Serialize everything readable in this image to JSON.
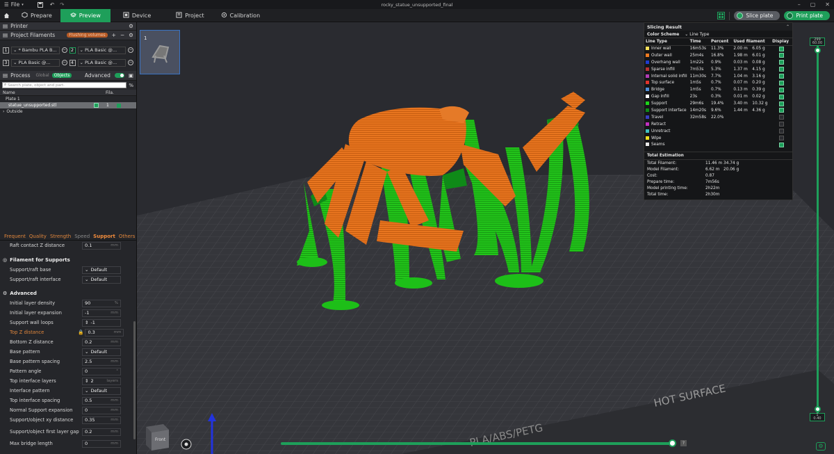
{
  "titlebar": {
    "file_menu": "File",
    "filename": "rocky_statue_unsupported_final"
  },
  "toolbar": {
    "tabs": [
      {
        "label": "Prepare",
        "icon": "prepare-icon"
      },
      {
        "label": "Preview",
        "icon": "preview-icon",
        "active": true
      },
      {
        "label": "Device",
        "icon": "device-icon"
      },
      {
        "label": "Project",
        "icon": "project-icon"
      },
      {
        "label": "Calibration",
        "icon": "calibration-icon"
      }
    ],
    "slice_label": "Slice plate",
    "print_label": "Print plate",
    "accent": "#1e9f5a"
  },
  "left": {
    "printer_title": "Printer",
    "filaments_title": "Project Filaments",
    "flushing_badge": "Flushing volumes",
    "filaments": [
      {
        "num": "1",
        "name": "* Bambu PLA B...",
        "color": "#2a2b30"
      },
      {
        "num": "2",
        "name": "PLA Basic @...",
        "color": "#1e9f5a"
      },
      {
        "num": "3",
        "name": "PLA Basic @...",
        "color": "#2a2b30"
      },
      {
        "num": "4",
        "name": "PLA Basic @...",
        "color": "#2a2b30"
      }
    ],
    "process_title": "Process",
    "global_label": "Global",
    "objects_label": "Objects",
    "advanced_label": "Advanced",
    "search_placeholder": "Search plate, object and part.",
    "col_name": "Name",
    "col_fila": "Fila.",
    "plate_label": "Plate 1",
    "object_name": "statue_unsupported.stl",
    "object_fila": "1",
    "outside_label": "Outside",
    "ptabs": [
      "Frequent",
      "Quality",
      "Strength",
      "Speed",
      "Support",
      "Others"
    ],
    "params_top": [
      {
        "label": "Raft contact Z distance",
        "value": "0.1",
        "unit": "mm"
      }
    ],
    "filament_supports_title": "Filament for Supports",
    "params_fil": [
      {
        "label": "Support/raft base",
        "value": "Default"
      },
      {
        "label": "Support/raft interface",
        "value": "Default"
      }
    ],
    "advanced_group": "Advanced",
    "params_adv": [
      {
        "label": "Initial layer density",
        "value": "90",
        "unit": "%"
      },
      {
        "label": "Initial layer expansion",
        "value": "-1",
        "unit": "mm"
      },
      {
        "label": "Support wall loops",
        "value": "-1",
        "unit": ""
      },
      {
        "label": "Top Z distance",
        "value": "0.3",
        "unit": "mm"
      },
      {
        "label": "Bottom Z distance",
        "value": "0.2",
        "unit": "mm"
      },
      {
        "label": "Base pattern",
        "value": "Default",
        "unit": ""
      },
      {
        "label": "Base pattern spacing",
        "value": "2.5",
        "unit": "mm"
      },
      {
        "label": "Pattern angle",
        "value": "0",
        "unit": "°"
      },
      {
        "label": "Top interface layers",
        "value": "2",
        "unit": "layers"
      },
      {
        "label": "Interface pattern",
        "value": "Default",
        "unit": ""
      },
      {
        "label": "Top interface spacing",
        "value": "0.5",
        "unit": "mm"
      },
      {
        "label": "Normal Support expansion",
        "value": "0",
        "unit": "mm"
      },
      {
        "label": "Support/object xy distance",
        "value": "0.35",
        "unit": "mm"
      },
      {
        "label": "Support/object first layer gap",
        "value": "0.2",
        "unit": "mm"
      },
      {
        "label": "Max bridge length",
        "value": "0",
        "unit": "mm"
      }
    ]
  },
  "plate": {
    "number": "1",
    "bed_text": "HOT SURFACE",
    "bed_text2": "PLA/ABS/PETG",
    "cube_label": "Front"
  },
  "result": {
    "title": "Slicing Result",
    "color_scheme_label": "Color Scheme",
    "color_scheme_value": "Line Type",
    "headers": [
      "Line Type",
      "Time",
      "Percent",
      "Used filament",
      "Display"
    ],
    "rows": [
      {
        "type": "Inner wall",
        "time": "16m53s",
        "percent": "11.3%",
        "length": "2.00 m",
        "weight": "6.05 g",
        "color": "#f7e15b",
        "on": true
      },
      {
        "type": "Outer wall",
        "time": "25m4s",
        "percent": "16.8%",
        "length": "1.98 m",
        "weight": "6.01 g",
        "color": "#ef7b21",
        "on": true
      },
      {
        "type": "Overhang wall",
        "time": "1m22s",
        "percent": "0.9%",
        "length": "0.03 m",
        "weight": "0.08 g",
        "color": "#1f3cd0",
        "on": true
      },
      {
        "type": "Sparse infill",
        "time": "7m53s",
        "percent": "5.3%",
        "length": "1.37 m",
        "weight": "4.15 g",
        "color": "#b83232",
        "on": true
      },
      {
        "type": "Internal solid infill",
        "time": "11m30s",
        "percent": "7.7%",
        "length": "1.04 m",
        "weight": "3.16 g",
        "color": "#b23cb6",
        "on": true
      },
      {
        "type": "Top surface",
        "time": "1m5s",
        "percent": "0.7%",
        "length": "0.07 m",
        "weight": "0.20 g",
        "color": "#e0342c",
        "on": true
      },
      {
        "type": "Bridge",
        "time": "1m5s",
        "percent": "0.7%",
        "length": "0.13 m",
        "weight": "0.39 g",
        "color": "#4f8fd8",
        "on": true
      },
      {
        "type": "Gap infill",
        "time": "23s",
        "percent": "0.3%",
        "length": "0.01 m",
        "weight": "0.02 g",
        "color": "#ffffff",
        "on": true
      },
      {
        "type": "Support",
        "time": "29m6s",
        "percent": "19.4%",
        "length": "3.40 m",
        "weight": "10.32 g",
        "color": "#1dd41a",
        "on": true
      },
      {
        "type": "Support interface",
        "time": "14m20s",
        "percent": "9.6%",
        "length": "1.44 m",
        "weight": "4.36 g",
        "color": "#0f8a18",
        "on": true
      },
      {
        "type": "Travel",
        "time": "32m58s",
        "percent": "22.0%",
        "length": "",
        "weight": "",
        "color": "#383ec0",
        "on": false
      },
      {
        "type": "Retract",
        "time": "",
        "percent": "",
        "length": "",
        "weight": "",
        "color": "#c030c0",
        "on": false
      },
      {
        "type": "Unretract",
        "time": "",
        "percent": "",
        "length": "",
        "weight": "",
        "color": "#40c0c0",
        "on": false
      },
      {
        "type": "Wipe",
        "time": "",
        "percent": "",
        "length": "",
        "weight": "",
        "color": "#f0e020",
        "on": false
      },
      {
        "type": "Seams",
        "time": "",
        "percent": "",
        "length": "",
        "weight": "",
        "color": "#e8e8e8",
        "on": true
      }
    ],
    "estimation_title": "Total Estimation",
    "estimation": [
      {
        "label": "Total Filament:",
        "a": "11.46 m",
        "b": "34.74 g"
      },
      {
        "label": "Model Filament:",
        "a": "6.62 m",
        "b": "20.06 g"
      },
      {
        "label": "Cost:",
        "a": "0.87",
        "b": ""
      },
      {
        "label": "Prepare time:",
        "a": "7m56s",
        "b": ""
      },
      {
        "label": "Model printing time:",
        "a": "2h22m",
        "b": ""
      },
      {
        "label": "Total time:",
        "a": "2h30m",
        "b": ""
      }
    ]
  },
  "layer_slider": {
    "top": "299\n60.00",
    "bottom": "1\n0.40"
  }
}
